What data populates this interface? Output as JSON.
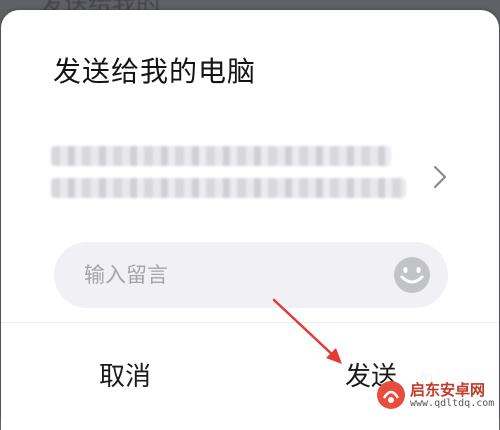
{
  "background_header": {
    "partial_title": "发送给我的电脑"
  },
  "dialog": {
    "title": "发送给我的电脑",
    "file_preview": {
      "line1": "███████ ████████████ ██████",
      "line2": "████████████████ ████████"
    },
    "message": {
      "placeholder": "输入留言",
      "value": ""
    },
    "actions": {
      "cancel_label": "取消",
      "send_label": "发送"
    }
  },
  "annotation": {
    "arrow_color": "#e53935"
  },
  "watermark": {
    "name": "启东安卓网",
    "url": "www.qdltdq.com"
  },
  "colors": {
    "dialog_bg": "#ffffff",
    "input_bg": "#f1f1f5",
    "placeholder": "#a4a4ac",
    "emoji_icon": "#c2c2c9",
    "text_primary": "#1b1b1b"
  }
}
